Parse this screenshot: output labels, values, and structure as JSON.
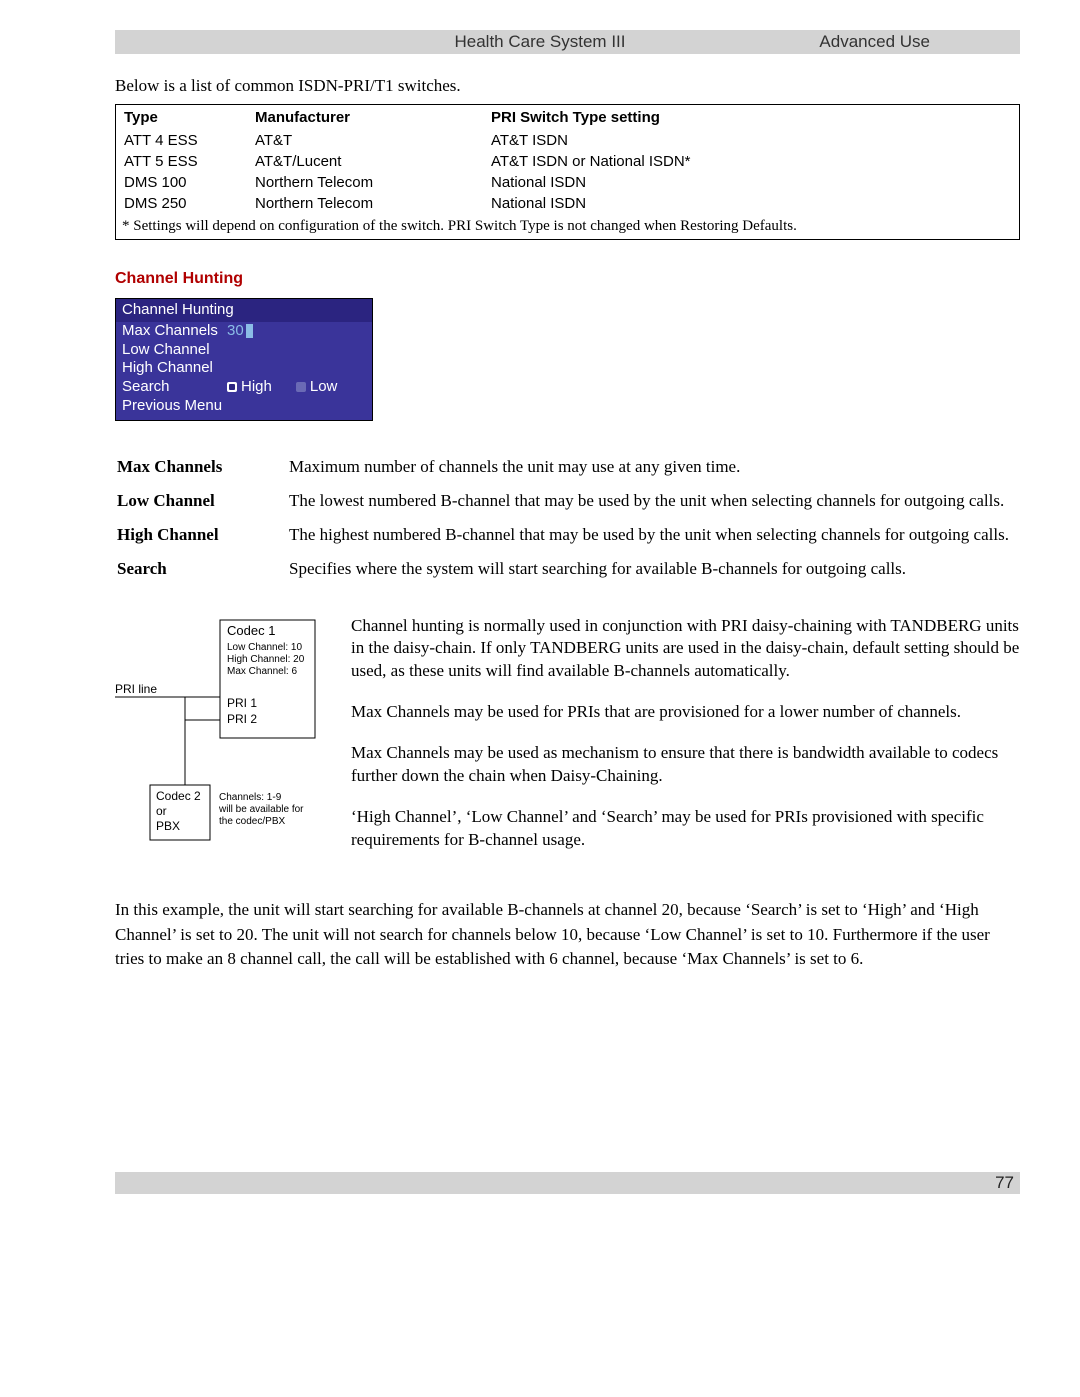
{
  "header": {
    "center": "Health Care System III",
    "right": "Advanced Use"
  },
  "intro": "Below is a list of common ISDN-PRI/T1 switches.",
  "table": {
    "headers": {
      "type": "Type",
      "mfr": "Manufacturer",
      "setting": "PRI Switch Type setting"
    },
    "rows": [
      {
        "type": "ATT 4 ESS",
        "mfr": "AT&T",
        "setting": "AT&T ISDN"
      },
      {
        "type": "ATT 5 ESS",
        "mfr": "AT&T/Lucent",
        "setting": "AT&T ISDN or National ISDN*"
      },
      {
        "type": "DMS 100",
        "mfr": "Northern Telecom",
        "setting": "National ISDN"
      },
      {
        "type": "DMS 250",
        "mfr": "Northern Telecom",
        "setting": "National ISDN"
      }
    ],
    "footnote": "* Settings will depend on configuration of the switch. PRI Switch Type is not changed when Restoring Defaults."
  },
  "section_heading": "Channel Hunting",
  "osd": {
    "title": "Channel Hunting",
    "rows": {
      "max_label": "Max Channels",
      "max_value": "30",
      "low_label": "Low Channel",
      "high_label": "High Channel",
      "search_label": "Search",
      "opt_high": "High",
      "opt_low": "Low",
      "prev": "Previous Menu"
    }
  },
  "definitions": [
    {
      "term": "Max Channels",
      "desc": "Maximum number of channels the unit may use at any given time."
    },
    {
      "term": "Low Channel",
      "desc": "The lowest numbered B-channel that may be used by the unit when selecting channels for outgoing calls."
    },
    {
      "term": "High Channel",
      "desc": "The highest numbered B-channel that may be used by the unit when selecting channels for outgoing calls."
    },
    {
      "term": "Search",
      "desc": "Specifies where the system will start searching for available B-channels for outgoing calls."
    }
  ],
  "diagram": {
    "pri_line": "PRI line",
    "codec1": {
      "title": "Codec 1",
      "l1": "Low Channel: 10",
      "l2": "High Channel: 20",
      "l3": "Max Channel: 6",
      "pri1": "PRI 1",
      "pri2": "PRI 2"
    },
    "codec2": {
      "title": "Codec 2",
      "l2": "or",
      "l3": "PBX",
      "note1": "Channels: 1-9",
      "note2": "will be available for",
      "note3": "the codec/PBX"
    }
  },
  "side_paras": [
    "Channel hunting is normally used in conjunction with PRI daisy-chaining with TANDBERG units in the daisy-chain. If only TANDBERG units are used in the daisy-chain, default setting should be used, as these units will find available B-channels automatically.",
    "Max Channels may be used for PRIs that are provisioned for a lower number of channels.",
    "Max Channels may be used as mechanism to ensure that there is bandwidth available to codecs further down the chain when Daisy-Chaining.",
    "‘High Channel’, ‘Low Channel’ and ‘Search’ may be used for PRIs provisioned with specific requirements for B-channel usage."
  ],
  "example": "In this example, the unit will start searching for available B-channels at channel 20, because ‘Search’ is set to ‘High’ and ‘High Channel’ is set to 20. The unit will not search for channels below 10, because ‘Low Channel’ is set to 10. Furthermore if the user tries to make an 8 channel call, the call will be established with 6 channel, because ‘Max Channels’ is set to 6.",
  "page_number": "77"
}
